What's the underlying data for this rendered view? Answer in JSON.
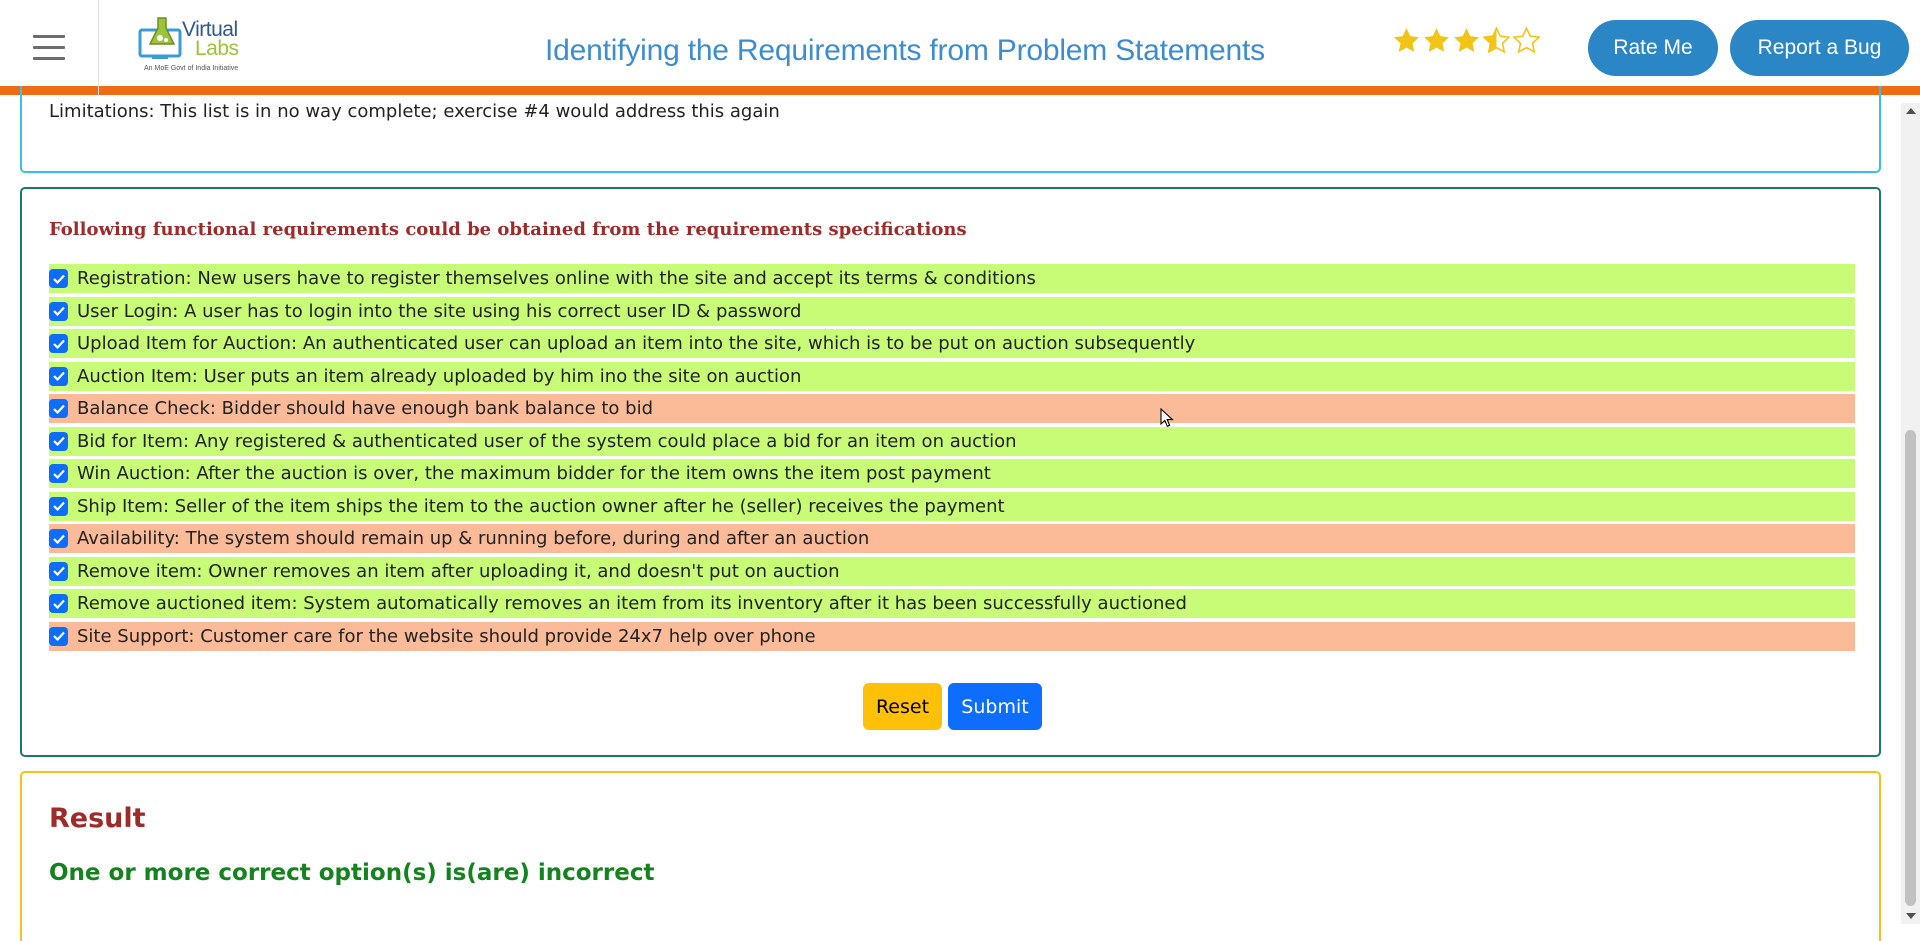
{
  "header": {
    "logo": {
      "word1": "Virtual",
      "word2": "Labs",
      "tagline": "An MoE Govt of India Initiative"
    },
    "title": "Identifying the Requirements from Problem Statements",
    "rating": {
      "value": 3.5,
      "max": 5,
      "color": "#f2c418"
    },
    "rate_label": "Rate Me",
    "bug_label": "Report a Bug"
  },
  "limitations_text": "Limitations: This list is in no way complete; exercise #4 would address this again",
  "requirements": {
    "heading": "Following functional requirements could be obtained from the requirements specifications",
    "items": [
      {
        "text": "Registration: New users have to register themselves online with the site and accept its terms & conditions",
        "checked": true,
        "status": "correct"
      },
      {
        "text": "User Login: A user has to login into the site using his correct user ID & password",
        "checked": true,
        "status": "correct"
      },
      {
        "text": "Upload Item for Auction: An authenticated user can upload an item into the site, which is to be put on auction subsequently",
        "checked": true,
        "status": "correct"
      },
      {
        "text": "Auction Item: User puts an item already uploaded by him ino the site on auction",
        "checked": true,
        "status": "correct"
      },
      {
        "text": "Balance Check: Bidder should have enough bank balance to bid",
        "checked": true,
        "status": "incorrect"
      },
      {
        "text": "Bid for Item: Any registered & authenticated user of the system could place a bid for an item on auction",
        "checked": true,
        "status": "correct"
      },
      {
        "text": "Win Auction: After the auction is over, the maximum bidder for the item owns the item post payment",
        "checked": true,
        "status": "correct"
      },
      {
        "text": "Ship Item: Seller of the item ships the item to the auction owner after he (seller) receives the payment",
        "checked": true,
        "status": "correct"
      },
      {
        "text": "Availability: The system should remain up & running before, during and after an auction",
        "checked": true,
        "status": "incorrect"
      },
      {
        "text": "Remove item: Owner removes an item after uploading it, and doesn't put on auction",
        "checked": true,
        "status": "correct"
      },
      {
        "text": "Remove auctioned item: System automatically removes an item from its inventory after it has been successfully auctioned",
        "checked": true,
        "status": "correct"
      },
      {
        "text": "Site Support: Customer care for the website should provide 24x7 help over phone",
        "checked": true,
        "status": "incorrect"
      }
    ],
    "reset_label": "Reset",
    "submit_label": "Submit"
  },
  "result": {
    "title": "Result",
    "message": "One or more correct option(s) is(are) incorrect"
  },
  "colors": {
    "correct_bg": "#c8fc76",
    "incorrect_bg": "#fbbb98",
    "accent_orange": "#f06a13",
    "button_blue": "#2a86c5"
  }
}
